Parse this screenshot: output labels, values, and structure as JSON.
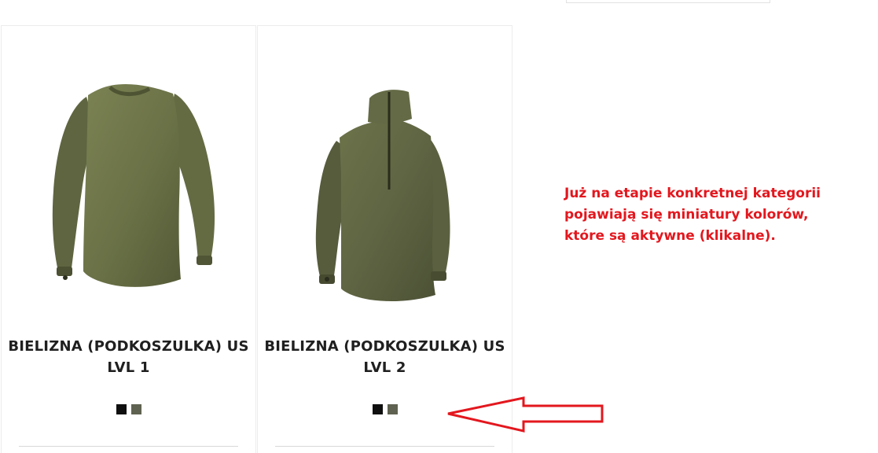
{
  "products": [
    {
      "title_line1": "BIELIZNA (PODKOSZULKA) US",
      "title_line2": "LVL 1",
      "swatches": [
        {
          "name": "black",
          "color": "#0f0f0f"
        },
        {
          "name": "olive",
          "color": "#5f6250"
        }
      ]
    },
    {
      "title_line1": "BIELIZNA (PODKOSZULKA) US",
      "title_line2": "LVL 2",
      "swatches": [
        {
          "name": "black",
          "color": "#0f0f0f"
        },
        {
          "name": "olive",
          "color": "#5f6250"
        }
      ]
    }
  ],
  "annotation": {
    "line1": "Już na etapie konkretnej kategorii",
    "line2": "pojawiają się miniatury kolorów,",
    "line3": "które są aktywne (klikalne)."
  },
  "colors": {
    "annotation_red": "#e3171e",
    "shirt_olive": "#6e7549",
    "fleece_olive": "#5f6545"
  }
}
